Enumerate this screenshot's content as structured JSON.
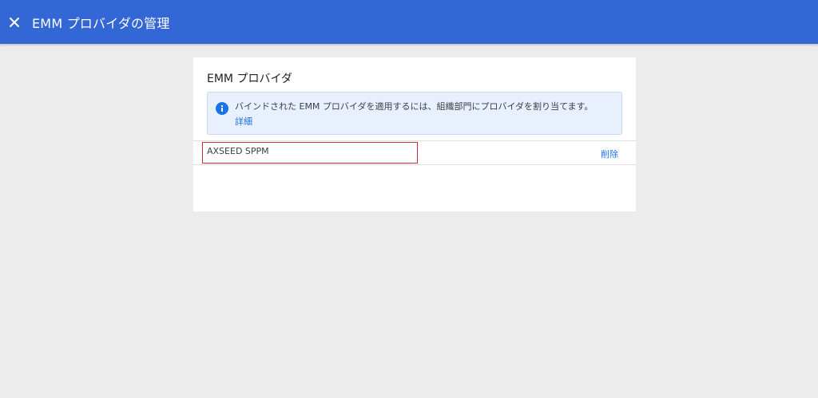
{
  "header": {
    "title": "EMM プロバイダの管理",
    "close_icon": "close-icon",
    "background_color": "#3367d6"
  },
  "card": {
    "title": "EMM プロバイダ",
    "info": {
      "icon": "info-icon",
      "text": "バインドされた EMM プロバイダを適用するには、組織部門にプロバイダを割り当てます。",
      "link": "詳細"
    },
    "providers": [
      {
        "name": "AXSEED SPPM",
        "action_label": "削除"
      }
    ]
  },
  "colors": {
    "accent": "#1a73e8",
    "highlight_border": "#d32f2f",
    "info_background": "#e8f0fe"
  }
}
